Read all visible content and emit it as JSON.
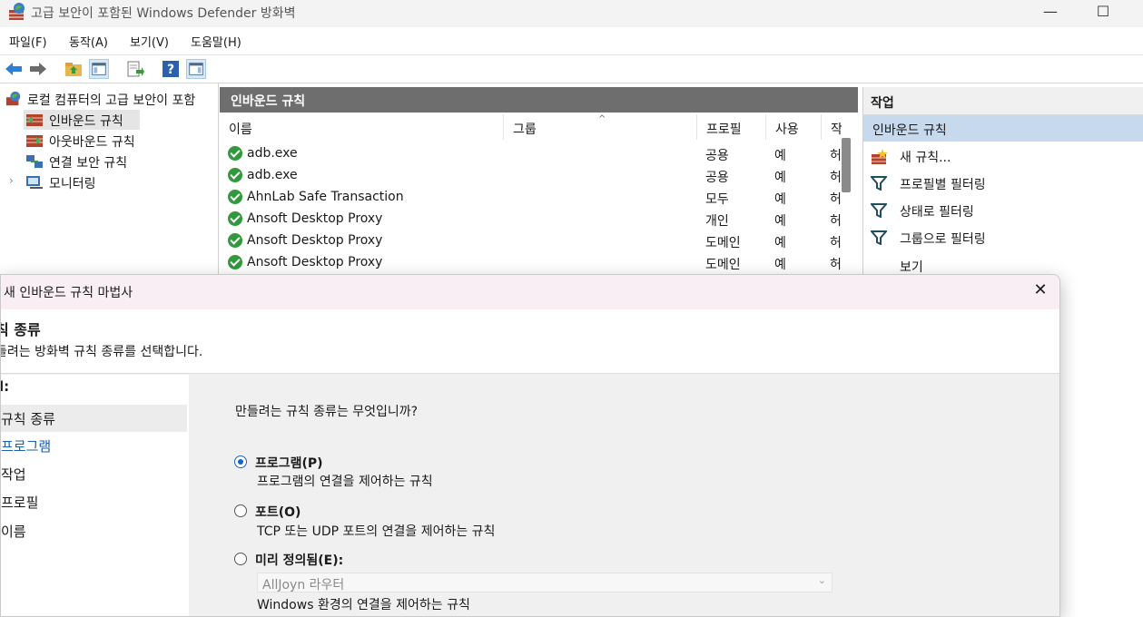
{
  "window": {
    "title": "고급 보안이 포함된 Windows Defender 방화벽",
    "minimize": "—",
    "maximize": "☐"
  },
  "menu": [
    "파일(F)",
    "동작(A)",
    "보기(V)",
    "도움말(H)"
  ],
  "toolbar": {
    "icons": [
      "back-arrow-icon",
      "forward-arrow-icon",
      "up-folder-icon",
      "show-hide-console-tree-icon",
      "export-list-icon",
      "help-icon",
      "show-hide-action-pane-icon"
    ]
  },
  "tree": {
    "root": "로컬 컴퓨터의 고급 보안이 포함",
    "items": [
      "인바운드 규칙",
      "아웃바운드 규칙",
      "연결 보안 규칙",
      "모니터링"
    ],
    "expander": "›"
  },
  "center": {
    "header": "인바운드 규칙",
    "sort_indicator": "^",
    "columns": [
      "이름",
      "그룹",
      "프로필",
      "사용",
      "작"
    ],
    "rows": [
      {
        "name": "adb.exe",
        "group": "",
        "profile": "공용",
        "enabled": "예",
        "action": "허"
      },
      {
        "name": "adb.exe",
        "group": "",
        "profile": "공용",
        "enabled": "예",
        "action": "허"
      },
      {
        "name": "AhnLab Safe Transaction",
        "group": "",
        "profile": "모두",
        "enabled": "예",
        "action": "허"
      },
      {
        "name": "Ansoft Desktop Proxy",
        "group": "",
        "profile": "개인",
        "enabled": "예",
        "action": "허"
      },
      {
        "name": "Ansoft Desktop Proxy",
        "group": "",
        "profile": "도메인",
        "enabled": "예",
        "action": "허"
      },
      {
        "name": "Ansoft Desktop Proxy",
        "group": "",
        "profile": "도메인",
        "enabled": "예",
        "action": "허"
      }
    ]
  },
  "actions": {
    "header": "작업",
    "section": "인바운드 규칙",
    "items": [
      "새 규칙...",
      "프로필별 필터링",
      "상태로 필터링",
      "그룹으로 필터링",
      "보기"
    ]
  },
  "wizard": {
    "title": "새 인바운드 규칙 마법사",
    "close": "✕",
    "heading": "칙 종류",
    "subheading": "들려는 방화벽 규칙 종류를 선택합니다.",
    "steps_label": "l:",
    "steps": [
      "규칙 종류",
      "프로그램",
      "작업",
      "프로필",
      "이름"
    ],
    "question": "만들려는 규칙 종류는 무엇입니까?",
    "options": [
      {
        "label": "프로그램(P)",
        "desc": "프로그램의 연결을 제어하는 규칙",
        "selected": true
      },
      {
        "label": "포트(O)",
        "desc": "TCP 또는 UDP 포트의 연결을 제어하는 규칙",
        "selected": false
      },
      {
        "label": "미리 정의됨(E):",
        "desc": "Windows 환경의 연결을 제어하는 규칙",
        "selected": false
      }
    ],
    "predefined_select": {
      "value": "AllJoyn 라우터",
      "arrow": "⌄"
    }
  }
}
